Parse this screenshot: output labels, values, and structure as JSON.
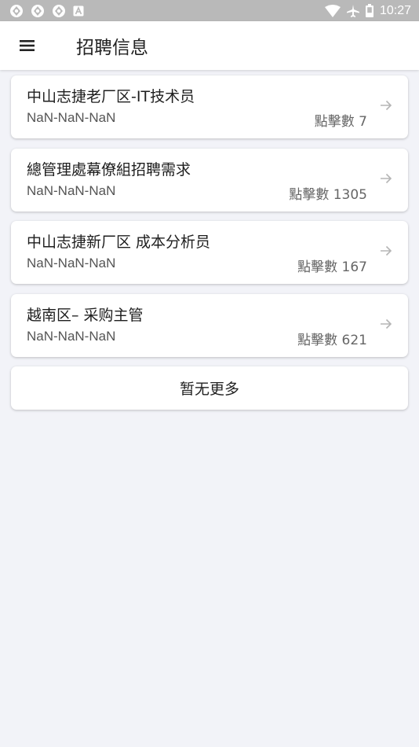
{
  "status_bar": {
    "time": "10:27",
    "icons": [
      "app-icon",
      "app-icon",
      "app-icon",
      "a-icon",
      "wifi-icon",
      "airplane-icon",
      "battery-icon"
    ]
  },
  "app_bar": {
    "title": "招聘信息",
    "menu_icon": "menu-icon"
  },
  "jobs": [
    {
      "title": "中山志捷老厂区-IT技术员",
      "date": "NaN-NaN-NaN",
      "clicks": "點擊數 7"
    },
    {
      "title": "總管理處幕僚組招聘需求",
      "date": "NaN-NaN-NaN",
      "clicks": "點擊數 1305"
    },
    {
      "title": "中山志捷新厂区 成本分析员",
      "date": "NaN-NaN-NaN",
      "clicks": "點擊數 167"
    },
    {
      "title": "越南区– 采购主管",
      "date": "NaN-NaN-NaN",
      "clicks": "點擊數 621"
    }
  ],
  "no_more": "暂无更多",
  "colors": {
    "status_bar": "#b9b9b9",
    "background": "#f2f3f8",
    "card": "#ffffff",
    "arrow": "#b5b5b5"
  }
}
